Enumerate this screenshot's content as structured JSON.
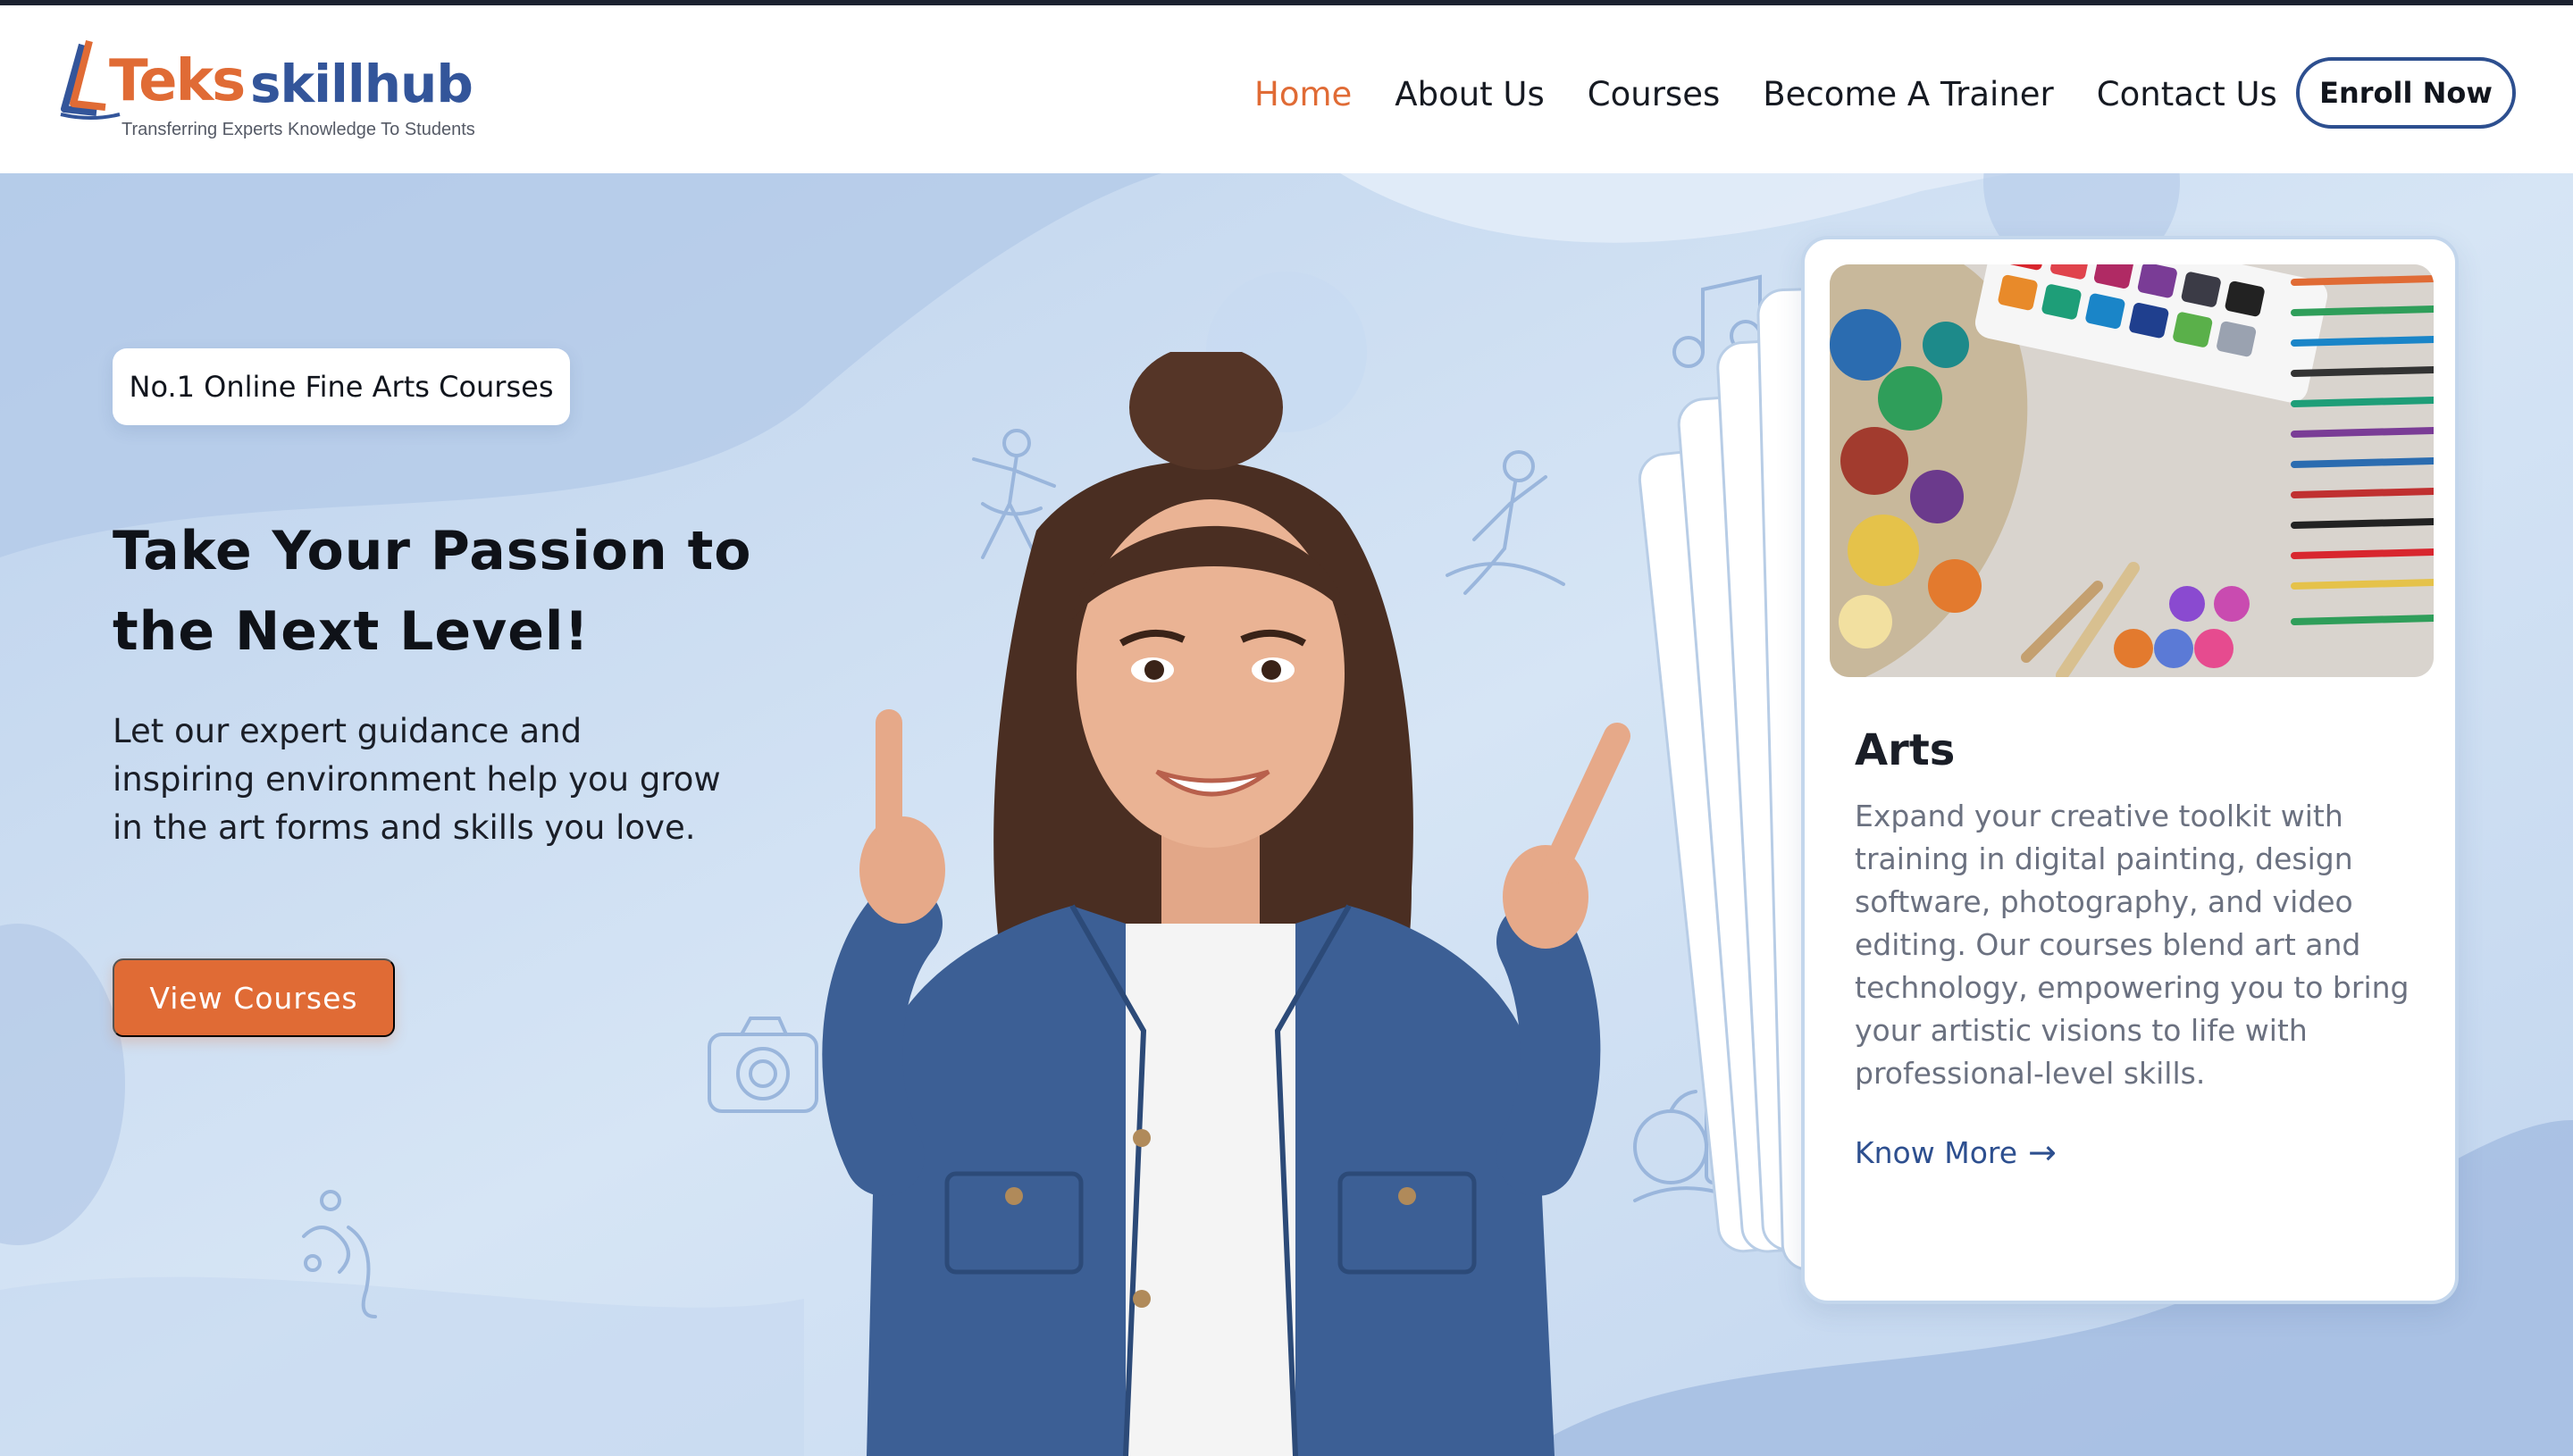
{
  "brand": {
    "name_part1": "Teks",
    "name_part2": "skillhub",
    "tagline": "Transferring Experts Knowledge To Students"
  },
  "nav": {
    "items": [
      {
        "label": "Home",
        "active": true
      },
      {
        "label": "About Us",
        "active": false
      },
      {
        "label": "Courses",
        "active": false
      },
      {
        "label": "Become A Trainer",
        "active": false
      },
      {
        "label": "Contact Us",
        "active": false
      }
    ],
    "cta_label": "Enroll Now"
  },
  "hero": {
    "badge": "No.1 Online Fine Arts Courses",
    "headline_line1": "Take Your Passion to",
    "headline_line2": "the Next Level!",
    "description_line1": "Let our expert guidance and",
    "description_line2": "inspiring environment help you grow",
    "description_line3": "in the art forms and skills you love.",
    "button_label": "View Courses"
  },
  "card": {
    "title": "Arts",
    "text": "Expand your creative toolkit with training in digital painting, design software, photography, and video editing. Our courses blend art and technology, empowering you to bring your artistic visions to life with professional-level skills.",
    "link_label": "Know More",
    "link_icon": "arrow-right-icon"
  },
  "colors": {
    "accent": "#e06b35",
    "brand_blue": "#33559a",
    "hero_bg": "#cddff2",
    "text_dark": "#11151d",
    "text_muted": "#6b7180"
  }
}
